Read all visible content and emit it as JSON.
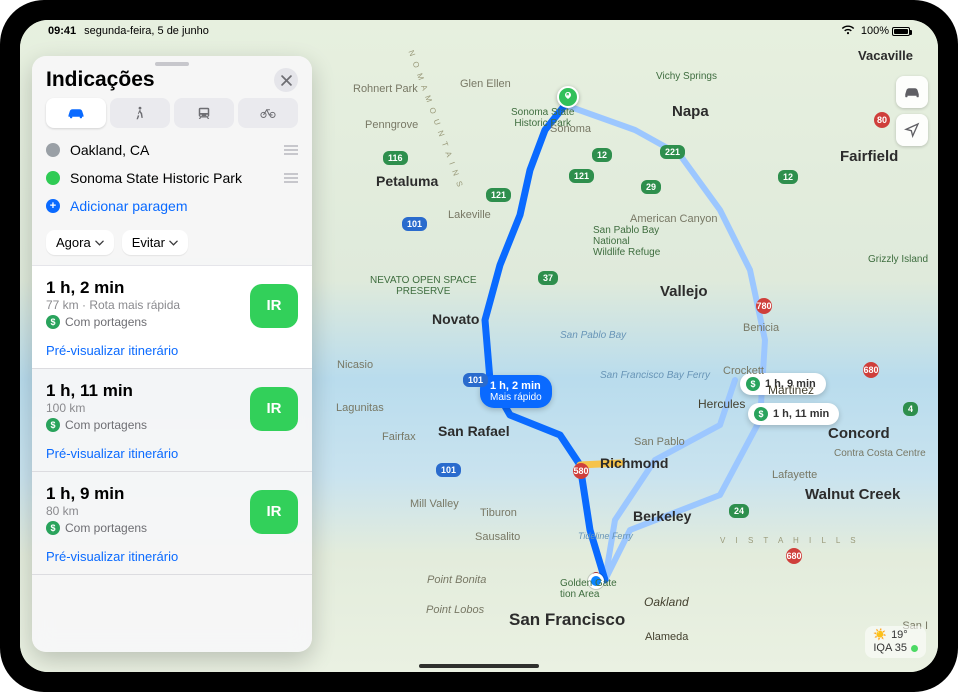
{
  "status": {
    "time": "09:41",
    "date": "segunda-feira, 5 de junho",
    "battery": "100%"
  },
  "panel": {
    "title": "Indicações",
    "stops": {
      "from": "Oakland, CA",
      "to": "Sonoma State Historic Park",
      "add": "Adicionar paragem"
    },
    "chips": {
      "now": "Agora",
      "avoid": "Evitar"
    }
  },
  "routes": [
    {
      "time": "1 h, 2 min",
      "meta": "77 km · Rota mais rápida",
      "toll": "Com portagens",
      "go": "IR",
      "preview": "Pré-visualizar itinerário"
    },
    {
      "time": "1 h, 11 min",
      "meta": "100 km",
      "toll": "Com portagens",
      "go": "IR",
      "preview": "Pré-visualizar itinerário"
    },
    {
      "time": "1 h, 9 min",
      "meta": "80 km",
      "toll": "Com portagens",
      "go": "IR",
      "preview": "Pré-visualizar itinerário"
    }
  ],
  "map_badges": {
    "primary_time": "1 h, 2 min",
    "primary_sub": "Mais rápido",
    "alt1": "1 h, 9 min",
    "alt2": "1 h, 11 min"
  },
  "weather": {
    "temp": "19°",
    "aqi_label": "IQA 35"
  },
  "cities": {
    "sf": "San Francisco",
    "oakland": "Oakland",
    "berkeley": "Berkeley",
    "richmond": "Richmond",
    "sanrafael": "San Rafael",
    "walnut": "Walnut Creek",
    "concord": "Concord",
    "martinez": "Martinez",
    "hercules": "Hercules",
    "vallejo": "Vallejo",
    "napa": "Napa",
    "fairfield": "Fairfield",
    "petaluma": "Petaluma",
    "novato": "Novato",
    "alameda": "Alameda",
    "vacaville": "Vacaville",
    "sonoma": "Sonoma",
    "sausalito": "Sausalito",
    "tiburon": "Tiburon",
    "millvalley": "Mill Valley",
    "rohnert": "Rohnert Park",
    "lafayette": "Lafayette",
    "benicia": "Benicia",
    "crockett": "Crockett",
    "american": "American Canyon",
    "lakeville": "Lakeville",
    "penngrove": "Penngrove",
    "glen": "Glen Ellen",
    "sani": "San I",
    "grizzly": "Grizzly Island",
    "sanpablobay": "San Pablo Bay",
    "sfbf": "San Francisco Bay Ferry",
    "tideline": "Tideline Ferry",
    "lagunitas": "Lagunitas",
    "fairfax": "Fairfax",
    "pointbonita": "Point Bonita",
    "pointlobos": "Point Lobos",
    "vistahills": "V I S T A   H I L L S",
    "openspace": "NEVATO OPEN SPACE",
    "openspace2": "PRESERVE",
    "ggnra": "Golden Gate",
    "ggnra2": "tion Area",
    "contra": "Contra Costa Centre",
    "spablo": "San Pablo",
    "sshp": "Sonoma State",
    "sshp2": "Historic Park",
    "spbnwr": "San Pablo Bay",
    "spbnwr2": "National",
    "spbnwr3": "Wildlife Refuge",
    "nomamtn": "N O M A   M O U N T A I N S"
  },
  "shields": {
    "i580": "580",
    "i680a": "680",
    "i680b": "680",
    "i780": "780",
    "i80": "80",
    "us101a": "101",
    "us101b": "101",
    "us101c": "101",
    "ca37": "37",
    "ca29": "29",
    "ca12a": "12",
    "ca12b": "12",
    "ca121a": "121",
    "ca121b": "121",
    "ca116": "116",
    "ca24": "24",
    "ca221": "221",
    "ca4": "4"
  }
}
